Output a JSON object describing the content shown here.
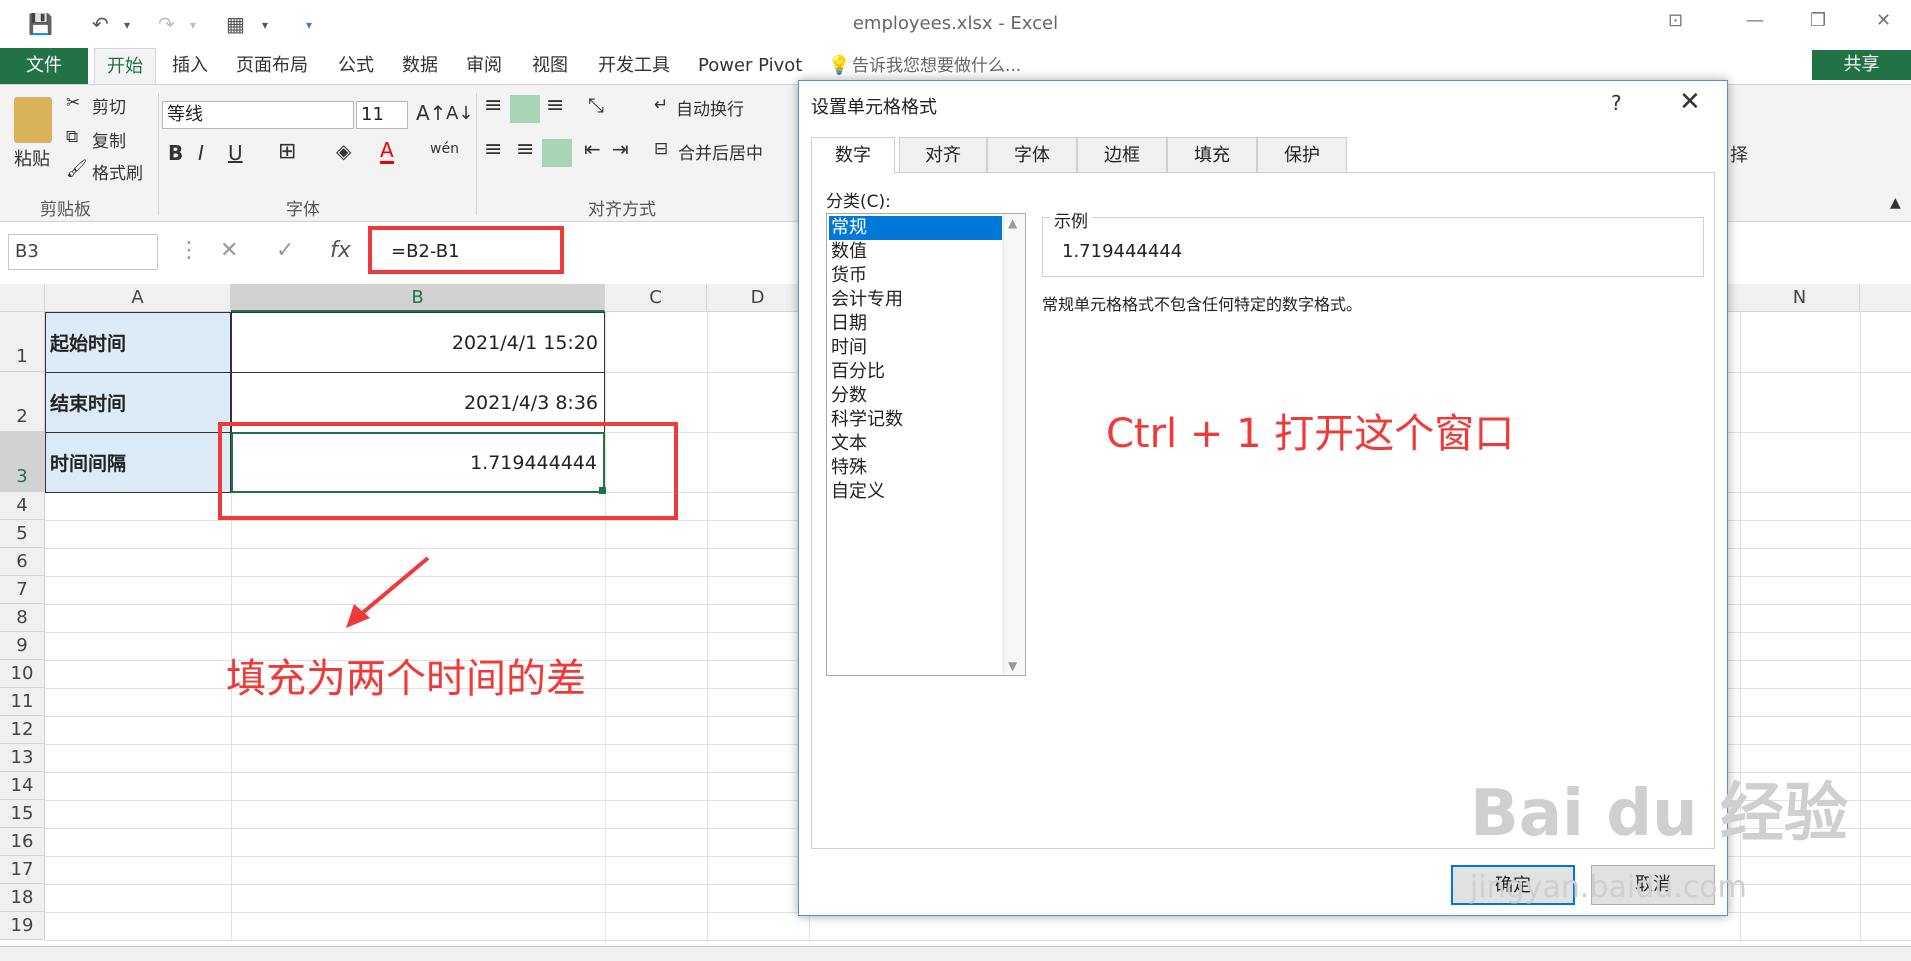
{
  "window": {
    "title": "employees.xlsx - Excel"
  },
  "ribbon_tabs": [
    "文件",
    "开始",
    "插入",
    "页面布局",
    "公式",
    "数据",
    "审阅",
    "视图",
    "开发工具",
    "Power Pivot"
  ],
  "tell_me": "告诉我您想要做什么...",
  "share": "共享",
  "ribbon": {
    "clipboard": {
      "paste": "粘贴",
      "cut": "剪切",
      "copy": "复制",
      "format_painter": "格式刷",
      "label": "剪贴板"
    },
    "font": {
      "name": "等线",
      "size": "11",
      "bold": "B",
      "italic": "I",
      "underline": "U",
      "label": "字体"
    },
    "alignment": {
      "wrap": "自动换行",
      "merge": "合并后居中",
      "label": "对齐方式"
    },
    "right_fragment": "择"
  },
  "formula_bar": {
    "name_box": "B3",
    "formula": "=B2-B1",
    "fx": "fx"
  },
  "columns": [
    "A",
    "B",
    "C",
    "D",
    "N"
  ],
  "rows": [
    "1",
    "2",
    "3",
    "4",
    "5",
    "6",
    "7",
    "8",
    "9",
    "10",
    "11",
    "12",
    "13",
    "14",
    "15",
    "16",
    "17",
    "18",
    "19"
  ],
  "cells": {
    "A1": "起始时间",
    "B1": "2021/4/1 15:20",
    "A2": "结束时间",
    "B2": "2021/4/3 8:36",
    "A3": "时间间隔",
    "B3": "1.719444444"
  },
  "annotations": {
    "fill_note": "填充为两个时间的差",
    "ctrl_note": "Ctrl + 1 打开这个窗口"
  },
  "dialog": {
    "title": "设置单元格格式",
    "help": "?",
    "tabs": [
      "数字",
      "对齐",
      "字体",
      "边框",
      "填充",
      "保护"
    ],
    "category_label": "分类(C):",
    "categories": [
      "常规",
      "数值",
      "货币",
      "会计专用",
      "日期",
      "时间",
      "百分比",
      "分数",
      "科学记数",
      "文本",
      "特殊",
      "自定义"
    ],
    "sample_label": "示例",
    "sample_value": "1.719444444",
    "description": "常规单元格格式不包含任何特定的数字格式。",
    "ok": "确定",
    "cancel": "取消"
  },
  "watermark": {
    "brand": "Bai du 经验",
    "url": "jingyan.baidu.com"
  },
  "colors": {
    "excel_green": "#217346",
    "annotation_red": "#f03a3a",
    "select_blue": "#0078d7"
  }
}
